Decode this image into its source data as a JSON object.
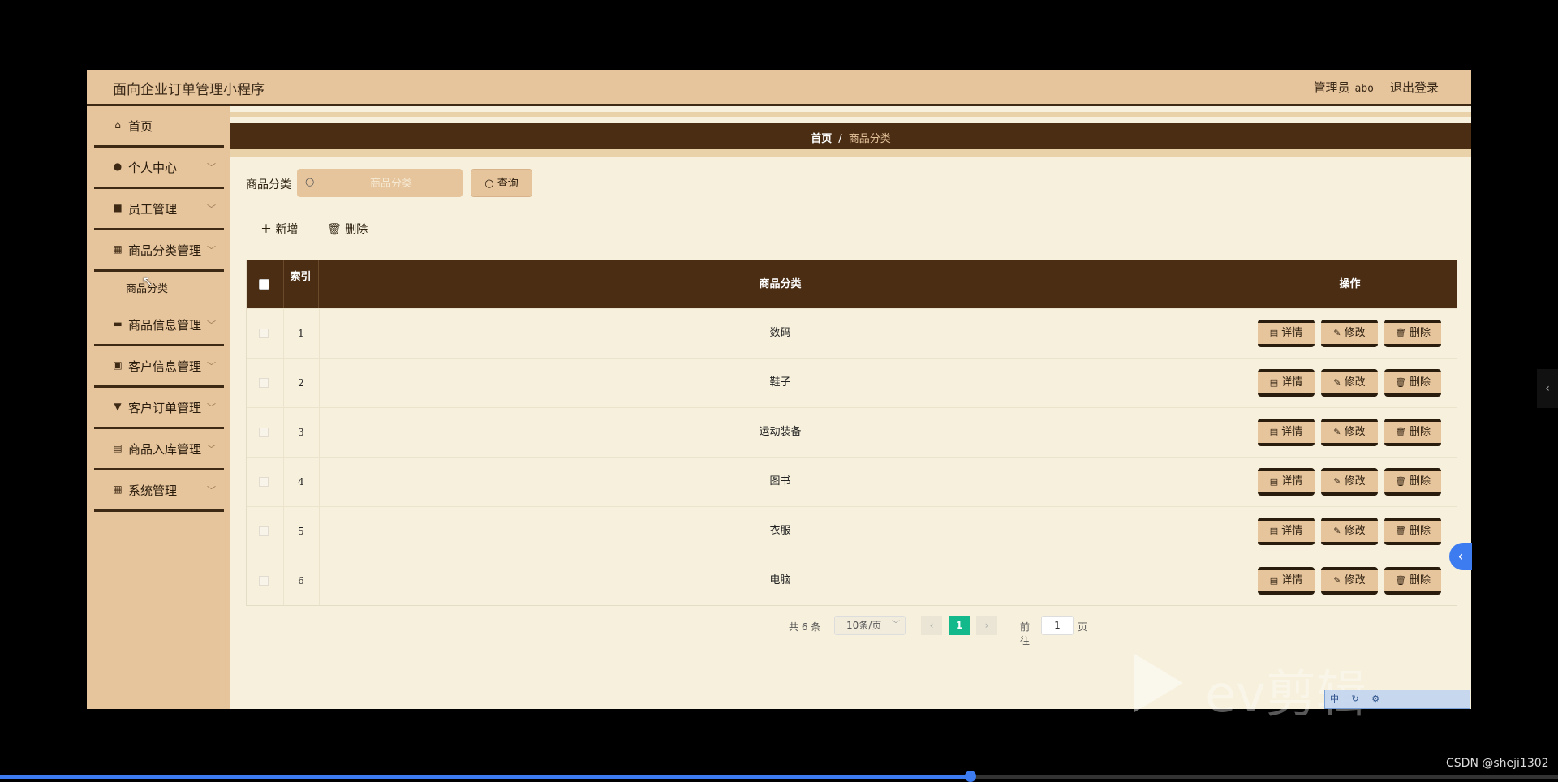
{
  "header": {
    "app_title": "面向企业订单管理小程序",
    "user_role": "管理员",
    "user_name": "abo",
    "logout_label": "退出登录"
  },
  "sidebar": {
    "items": [
      {
        "label": "首页",
        "icon": "home-icon"
      },
      {
        "label": "个人中心",
        "icon": "user-icon"
      },
      {
        "label": "员工管理",
        "icon": "staff-icon"
      },
      {
        "label": "商品分类管理",
        "icon": "grid-icon"
      },
      {
        "label": "商品信息管理",
        "icon": "chat-icon"
      },
      {
        "label": "客户信息管理",
        "icon": "chart-icon"
      },
      {
        "label": "客户订单管理",
        "icon": "order-icon"
      },
      {
        "label": "商品入库管理",
        "icon": "clipboard-icon"
      },
      {
        "label": "系统管理",
        "icon": "grid-icon"
      }
    ],
    "submenu_item": "商品分类"
  },
  "breadcrumb": {
    "home": "首页",
    "separator": "/",
    "current": "商品分类"
  },
  "search": {
    "label": "商品分类",
    "placeholder": "商品分类",
    "button_label": "查询"
  },
  "toolbar": {
    "add_label": "新增",
    "delete_label": "删除"
  },
  "table": {
    "headers": {
      "index": "索引",
      "name": "商品分类",
      "ops": "操作"
    },
    "rows": [
      {
        "index": "1",
        "name": "数码"
      },
      {
        "index": "2",
        "name": "鞋子"
      },
      {
        "index": "3",
        "name": "运动装备"
      },
      {
        "index": "4",
        "name": "图书"
      },
      {
        "index": "5",
        "name": "衣服"
      },
      {
        "index": "6",
        "name": "电脑"
      }
    ],
    "row_actions": {
      "detail": "详情",
      "edit": "修改",
      "delete": "删除"
    }
  },
  "pagination": {
    "total_text": "共 6 条",
    "page_size": "10条/页",
    "current_page": "1",
    "goto_label": "前往",
    "goto_value": "1",
    "page_suffix": "页"
  },
  "overlay": {
    "watermark": "ev剪辑",
    "ime_text": "中",
    "credit": "CSDN @sheji1302"
  },
  "video_progress": 0.623,
  "colors": {
    "header_bg": "#e6c49c",
    "dark_brown": "#4b2d14",
    "content_bg": "#f6f0dc",
    "page_active": "#13b98b",
    "accent_blue": "#3d7cf0"
  }
}
